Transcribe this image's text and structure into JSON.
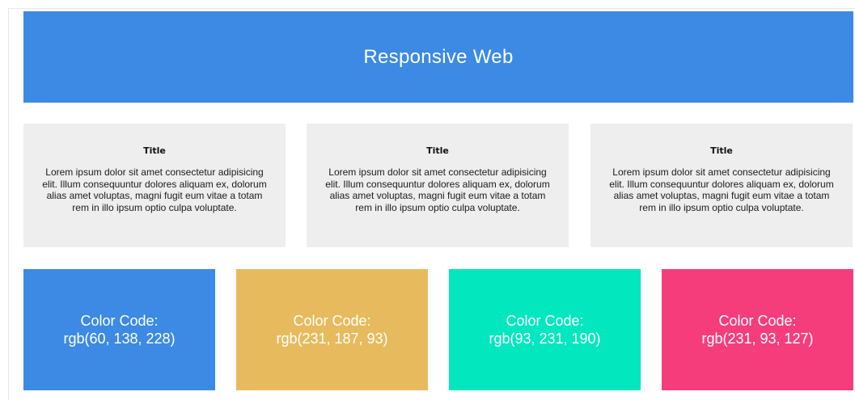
{
  "header": {
    "title": "Responsive Web"
  },
  "cards": [
    {
      "title": "Title",
      "body": "Lorem ipsum dolor sit amet consectetur adipisicing elit. Illum consequuntur dolores aliquam ex, dolorum alias amet voluptas, magni fugit eum vitae a totam rem in illo ipsum optio culpa voluptate."
    },
    {
      "title": "Title",
      "body": "Lorem ipsum dolor sit amet consectetur adipisicing elit. Illum consequuntur dolores aliquam ex, dolorum alias amet voluptas, magni fugit eum vitae a totam rem in illo ipsum optio culpa voluptate."
    },
    {
      "title": "Title",
      "body": "Lorem ipsum dolor sit amet consectetur adipisicing elit. Illum consequuntur dolores aliquam ex, dolorum alias amet voluptas, magni fugit eum vitae a totam rem in illo ipsum optio culpa voluptate."
    }
  ],
  "swatches": [
    {
      "label": "Color Code:",
      "code": "rgb(60, 138, 228)",
      "color": "#3c8ae4"
    },
    {
      "label": "Color Code:",
      "code": "rgb(231, 187, 93)",
      "color": "#e7bb5d"
    },
    {
      "label": "Color Code:",
      "code": "rgb(93, 231, 190)",
      "color": "#03e7be"
    },
    {
      "label": "Color Code:",
      "code": "rgb(231, 93, 127)",
      "color": "#f63d7c"
    }
  ]
}
